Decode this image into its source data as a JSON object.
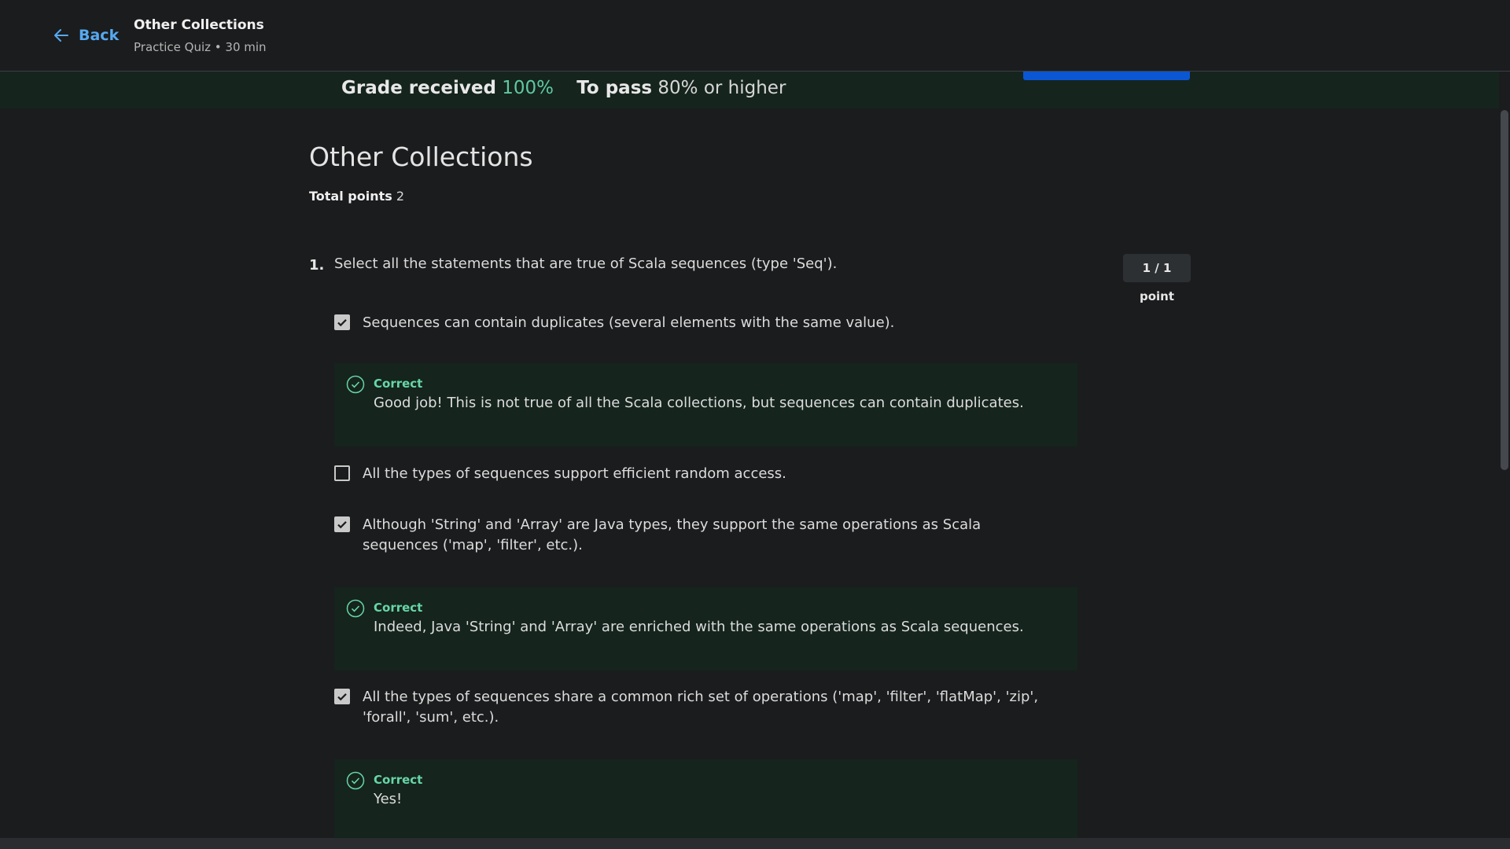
{
  "header": {
    "back_label": "Back",
    "title": "Other Collections",
    "subtitle": "Practice Quiz • 30 min"
  },
  "grade": {
    "received_label": "Grade received",
    "received_value": "100%",
    "pass_label": "To pass",
    "pass_value": "80% or higher"
  },
  "quiz": {
    "title": "Other Collections",
    "total_label": "Total points",
    "total_value": "2"
  },
  "question": {
    "number": "1.",
    "text": "Select all the statements that are true of Scala sequences (type 'Seq').",
    "points": "1 / 1 point",
    "options": [
      {
        "text": "Sequences can contain duplicates (several elements with the same value).",
        "checked": true
      },
      {
        "text": "All the types of sequences support efficient random access.",
        "checked": false
      },
      {
        "text": "Although 'String' and 'Array' are Java types, they support the same operations as Scala sequences ('map', 'filter', etc.).",
        "checked": true
      },
      {
        "text": "All the types of sequences share a common rich set of operations ('map', 'filter', 'flatMap', 'zip', 'forall', 'sum', etc.).",
        "checked": true
      }
    ],
    "feedback": [
      {
        "title": "Correct",
        "text": "Good job! This is not true of all the Scala collections, but sequences can contain duplicates."
      },
      {
        "title": "Correct",
        "text": "Indeed, Java 'String' and 'Array' are enriched with the same operations as Scala sequences."
      },
      {
        "title": "Correct",
        "text": "Yes!"
      }
    ]
  },
  "colors": {
    "accent_blue": "#56a9f0",
    "correct_green": "#67d6a7",
    "feedback_bg": "#15241d",
    "primary_button": "#0b56d2"
  }
}
